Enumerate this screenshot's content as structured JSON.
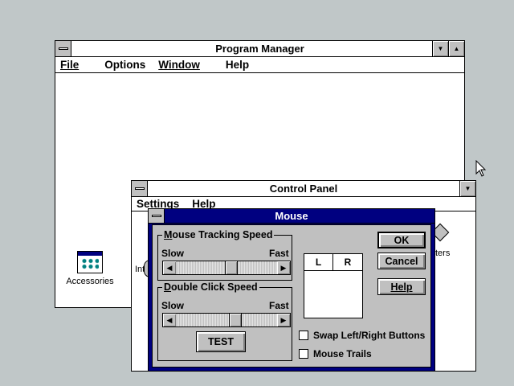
{
  "program_manager": {
    "title": "Program Manager",
    "menu": [
      "File",
      "Options",
      "Window",
      "Help"
    ],
    "icon_label": "Accessories"
  },
  "control_panel": {
    "title": "Control Panel",
    "menu": [
      "Settings",
      "Help"
    ],
    "partial_left_label": "Inte",
    "partial_right_label": "ters"
  },
  "mouse_dialog": {
    "title": "Mouse",
    "tracking": {
      "label": "Mouse Tracking Speed",
      "slow": "Slow",
      "fast": "Fast",
      "value": 0.55
    },
    "double_click": {
      "label": "Double Click Speed",
      "slow": "Slow",
      "fast": "Fast",
      "value": 0.6
    },
    "test_label": "TEST",
    "buttons": {
      "L": "L",
      "R": "R"
    },
    "ok": "OK",
    "cancel": "Cancel",
    "help": "Help",
    "swap_label": "Swap Left/Right Buttons",
    "trails_label": "Mouse Trails"
  },
  "icons": {
    "scroll_left": "left-arrow-icon",
    "scroll_right": "right-arrow-icon"
  }
}
